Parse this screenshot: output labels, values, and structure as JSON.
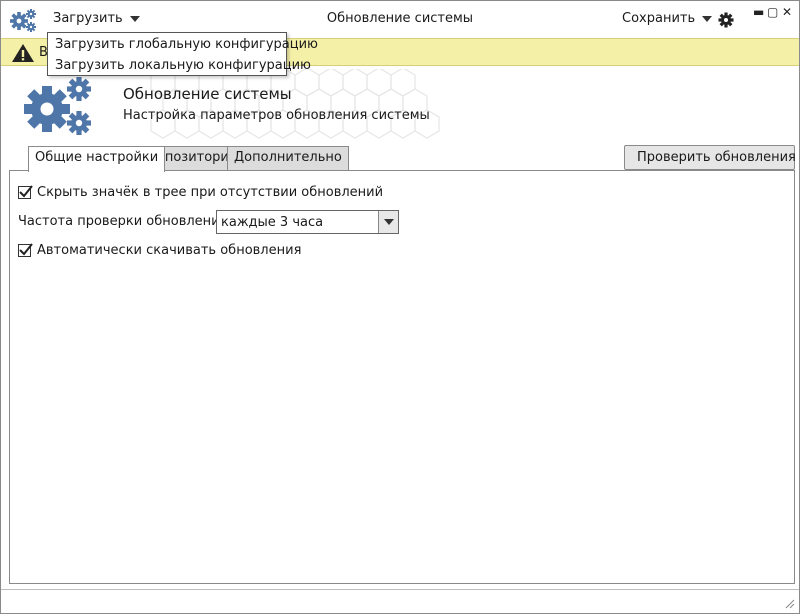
{
  "window": {
    "title": "Обновление системы",
    "controls": {
      "minimize": "▬",
      "maximize": "▢",
      "close": "✕"
    }
  },
  "menu": {
    "load_label": "Загрузить",
    "save_label": "Сохранить",
    "load_items": [
      "Загрузить глобальную конфигурацию",
      "Загрузить локальную конфигурацию"
    ]
  },
  "banner": {
    "text": "В",
    "icon": "warning-icon",
    "color": "#f5f0a8"
  },
  "header": {
    "title": "Обновление системы",
    "subtitle": "Настройка параметров обновления системы",
    "icon": "gears-icon",
    "accent_color": "#4f76a8"
  },
  "tabs": [
    {
      "label": "Общие настройки",
      "active": true
    },
    {
      "label": "Репозитории",
      "active": false
    },
    {
      "label": "Дополнительно",
      "active": false
    }
  ],
  "check_button_label": "Проверить обновления",
  "settings": {
    "hide_tray_icon": {
      "label": "Скрыть значёк в трее при отсутствии обновлений",
      "checked": true
    },
    "frequency": {
      "label": "Частота проверки обновлений",
      "value": "каждые 3 часа"
    },
    "auto_download": {
      "label": "Автоматически скачивать обновления",
      "checked": true
    }
  }
}
